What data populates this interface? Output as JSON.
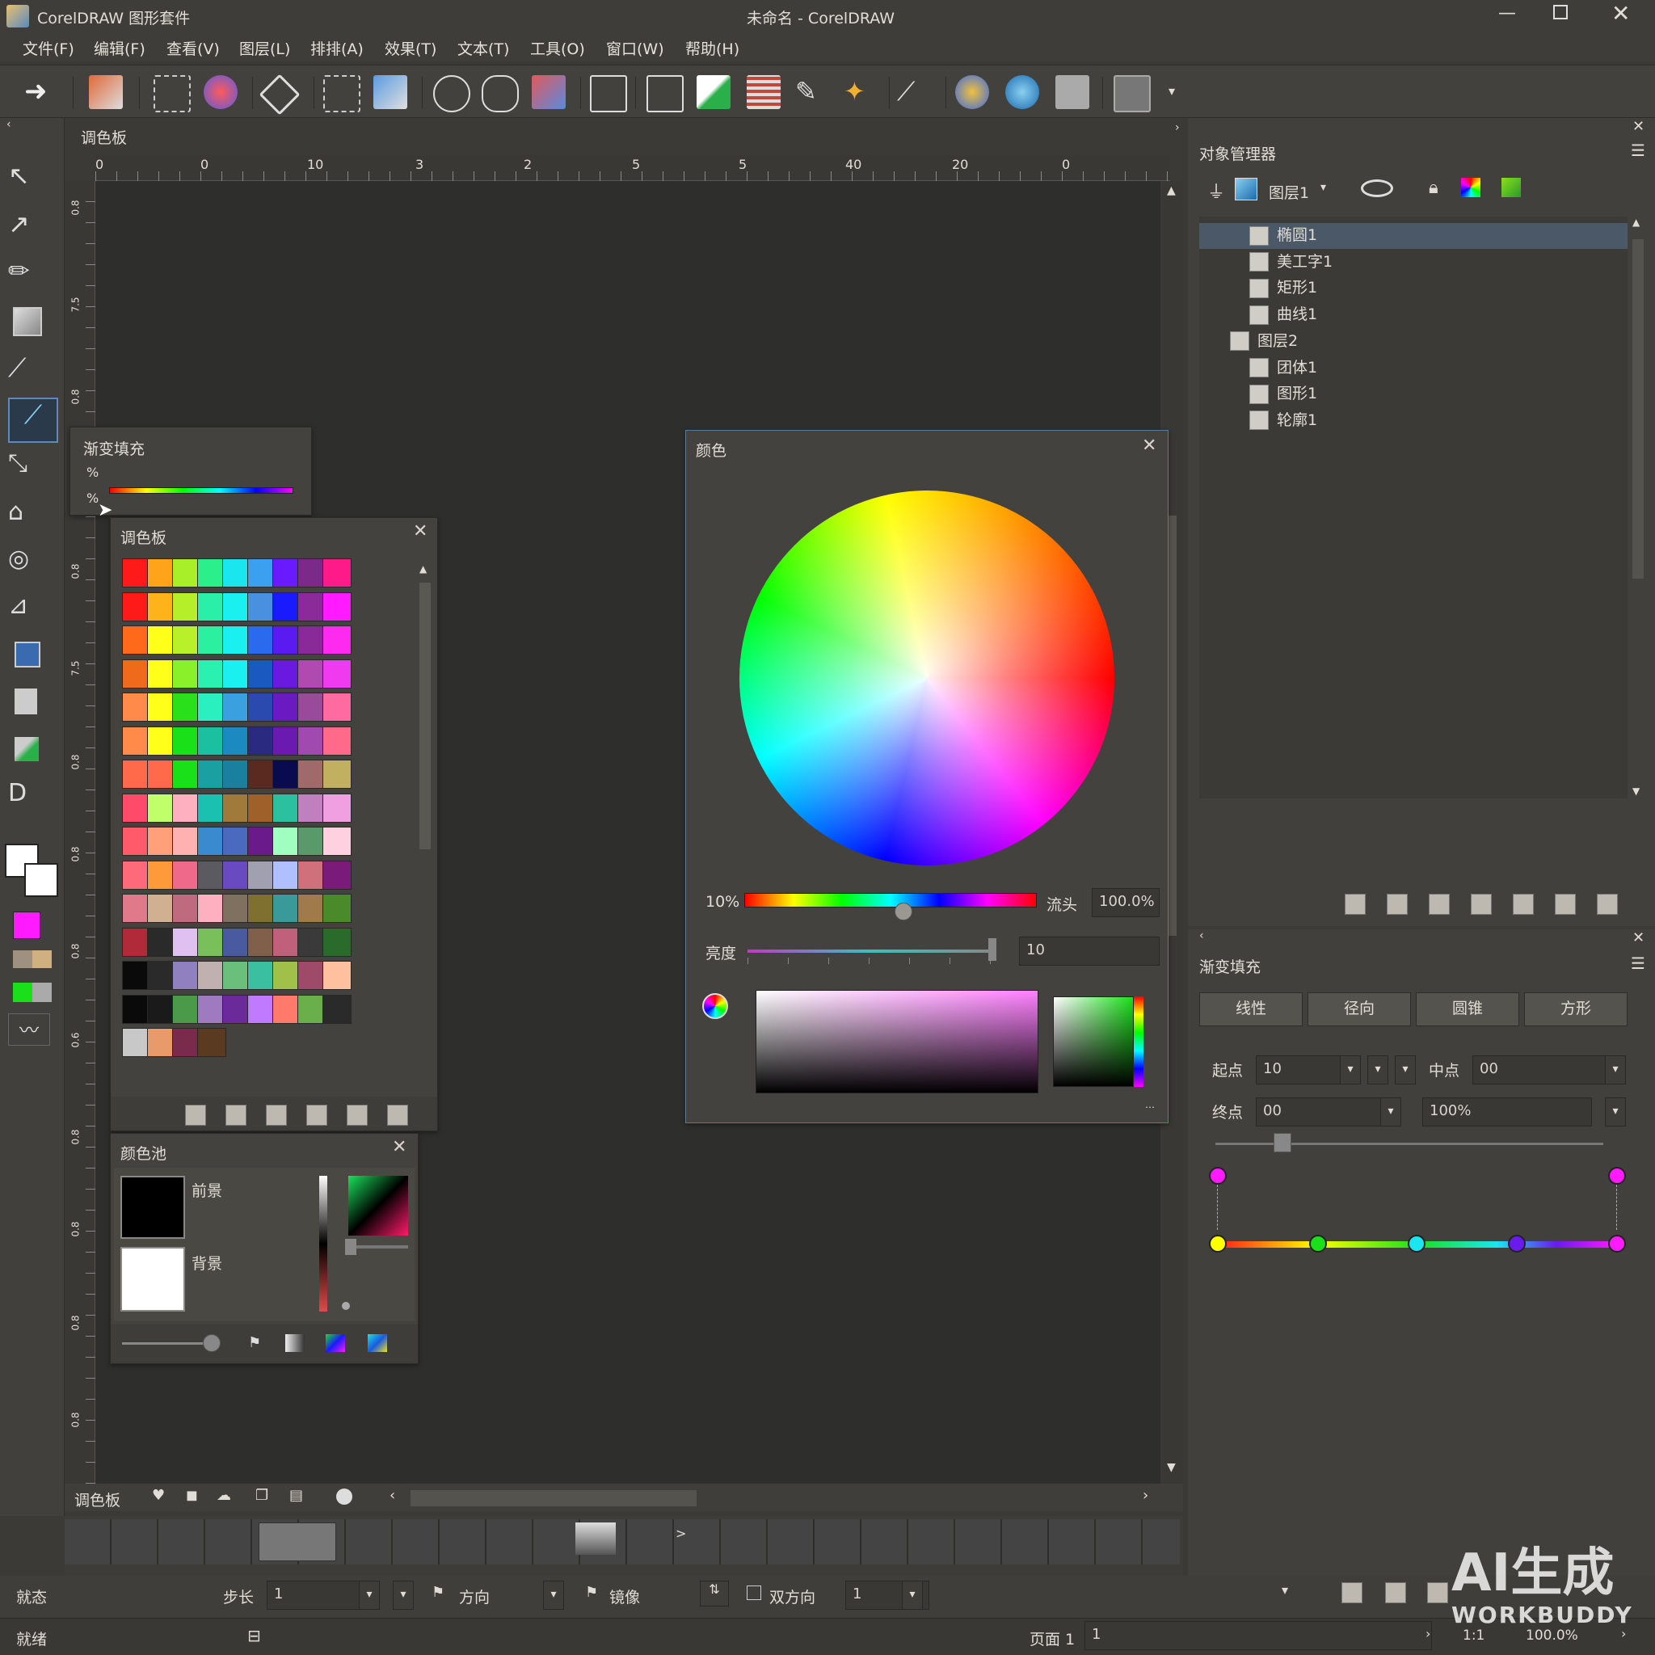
{
  "title": {
    "app_name": "CorelDRAW 图形套件",
    "doc_title": "未命名 - CorelDRAW"
  },
  "menu": [
    "文件(F)",
    "编辑(F)",
    "查看(V)",
    "图层(L)",
    "排排(A)",
    "效果(T)",
    "文本(T)",
    "工具(O)",
    "窗口(W)",
    "帮助(H)"
  ],
  "doc_tab": "调色板",
  "ruler_h_labels": [
    "0",
    "0",
    "10",
    "3",
    "2",
    "5",
    "5",
    "40",
    "20",
    "0"
  ],
  "ruler_v_labels": [
    "0.8",
    "7.5",
    "0.8",
    "0.8",
    "7.5",
    "0.8",
    "0.8",
    "0.8",
    "0",
    "0.6",
    "0.8",
    "0.8",
    "0.8",
    "0.8"
  ],
  "flyout": {
    "title": "渐变填充",
    "pct1": "%",
    "pct2": "%"
  },
  "palette": {
    "title": "调色板",
    "swatches": [
      [
        "#ff1a1a",
        "#ffa31a",
        "#a8ef2a",
        "#2aef8a",
        "#1ae6f0",
        "#3aa0ef",
        "#6a1aff",
        "#7b2a8a",
        "#ff1a8a"
      ],
      [
        "#ff1a1a",
        "#ffb31a",
        "#b5ef2a",
        "#2aefa8",
        "#1af0f0",
        "#4a90e0",
        "#1a1aff",
        "#8b2a9a",
        "#ff1aff"
      ],
      [
        "#ff6a1a",
        "#ffff1a",
        "#b8f02a",
        "#2af0a0",
        "#1af0f0",
        "#2a6aef",
        "#5a1af0",
        "#8a2a9a",
        "#ff2aef"
      ],
      [
        "#ef6a1a",
        "#ffff1a",
        "#8af02a",
        "#2af0b0",
        "#1af0f0",
        "#1a5ac0",
        "#6a1ae0",
        "#b04ab0",
        "#ef3aef"
      ],
      [
        "#ff8a4a",
        "#ffff1a",
        "#2ae01a",
        "#2af0c0",
        "#3aa0e0",
        "#2a4ab0",
        "#6a1ac0",
        "#9a4a9a",
        "#ff6aa0"
      ],
      [
        "#ff8a4a",
        "#ffff1a",
        "#1ae01a",
        "#1ac0a0",
        "#1a8ac0",
        "#2a2a80",
        "#6a1ab0",
        "#a04ab0",
        "#ff6a8a"
      ],
      [
        "#ff6a4a",
        "#ff6a4a",
        "#1ae01a",
        "#1aa0a0",
        "#1a80a0",
        "#5a2a20",
        "#0a0a50",
        "#a06a6a",
        "#c0b060"
      ],
      [
        "#ff4a6a",
        "#c0ff6a",
        "#ffb0c0",
        "#1ac0b0",
        "#a07a3a",
        "#a0602a",
        "#2ac0a0",
        "#c080c0",
        "#f0a0e0"
      ],
      [
        "#ff5a6a",
        "#ffa07a",
        "#ffb0b0",
        "#3a8ad0",
        "#4a6ac0",
        "#6a1a8a",
        "#a0ffc0",
        "#5a9a6a",
        "#ffd0e0"
      ],
      [
        "#ff6a7a",
        "#ff9a3a",
        "#ef6a8a",
        "#5a5a60",
        "#6a4ac0",
        "#a0a0b0",
        "#b0c0ff",
        "#d0707a",
        "#7a1a7a"
      ],
      [
        "#e07a8a",
        "#d0b090",
        "#c06a80",
        "#ffb0c0",
        "#807060",
        "#807030",
        "#3a9a9a",
        "#a07a4a",
        "#4a8a2a"
      ],
      [
        "#b02a3a",
        "#2a2a2a",
        "#e0c0f0",
        "#7ac05a",
        "#4a5aa0",
        "#80604a",
        "#c0607a",
        "#3a3a3a",
        "#2a6a2a"
      ],
      [
        "#0a0a0a",
        "#2a2a2a",
        "#9080c0",
        "#c0b0b0",
        "#6ac07a",
        "#3ac0a0",
        "#a0c04a",
        "#a04a6a",
        "#ffc0a0"
      ],
      [
        "#0a0a0a",
        "#1a1a1a",
        "#4a9a4a",
        "#a07ac0",
        "#6a2a9a",
        "#c07aff",
        "#ff7a6a",
        "#6ab04a",
        "#2a2a2a"
      ],
      [
        "#c8c8c8",
        "#e89a6a",
        "#7a2a4a",
        "#5a3a20"
      ]
    ]
  },
  "color_pool": {
    "title": "颜色池",
    "foreground_label": "前景",
    "background_label": "背景"
  },
  "color_dialog": {
    "title": "颜色",
    "hue_left_label": "10%",
    "hue_right_label": "流头",
    "hue_value": "100.0%",
    "brightness_label": "亮度",
    "brightness_value": "10"
  },
  "object_manager": {
    "title": "对象管理器",
    "layer_selector": "图层1",
    "items": [
      {
        "label": "椭圆1",
        "indent": 2,
        "selected": true
      },
      {
        "label": "美工字1",
        "indent": 2,
        "selected": false
      },
      {
        "label": "矩形1",
        "indent": 2,
        "selected": false
      },
      {
        "label": "曲线1",
        "indent": 2,
        "selected": false
      },
      {
        "label": "图层2",
        "indent": 1,
        "selected": false
      },
      {
        "label": "团体1",
        "indent": 2,
        "selected": false
      },
      {
        "label": "图形1",
        "indent": 2,
        "selected": false
      },
      {
        "label": "轮廓1",
        "indent": 2,
        "selected": false
      }
    ]
  },
  "gradient_panel": {
    "title": "渐变填充",
    "types": [
      "线性",
      "径向",
      "圆锥",
      "方形"
    ],
    "start_label": "起点",
    "start_value": "10",
    "mid_label": "中点",
    "mid_value": "00",
    "end_label": "终点",
    "end_value": "00",
    "percent_value": "100%",
    "stop_colors": [
      "#ffff00",
      "#1ae01a",
      "#1ae6f0",
      "#6a1aef",
      "#ff1aff"
    ],
    "top_stop_colors": [
      "#ff1aff",
      "#ff1aff"
    ]
  },
  "bottom_palette_bar": {
    "label": "调色板"
  },
  "property_bar": {
    "mode_label": "就态",
    "step_label": "步长",
    "step_value": "1",
    "direction_label": "方向",
    "mirror_label": "镜像",
    "bidirectional_label": "双方向",
    "count_value": "1"
  },
  "status_bar": {
    "left_text": "就绪",
    "page_label": "页面 1",
    "page_value": "1",
    "ratio": "1:1",
    "zoom": "100.0%"
  },
  "watermark": {
    "line1": "AI生成",
    "line2": "WORKBUDDY"
  },
  "colors": {
    "accent_magenta": "#ff1aff",
    "foreground_color": "#000000",
    "background_color": "#ffffff"
  }
}
